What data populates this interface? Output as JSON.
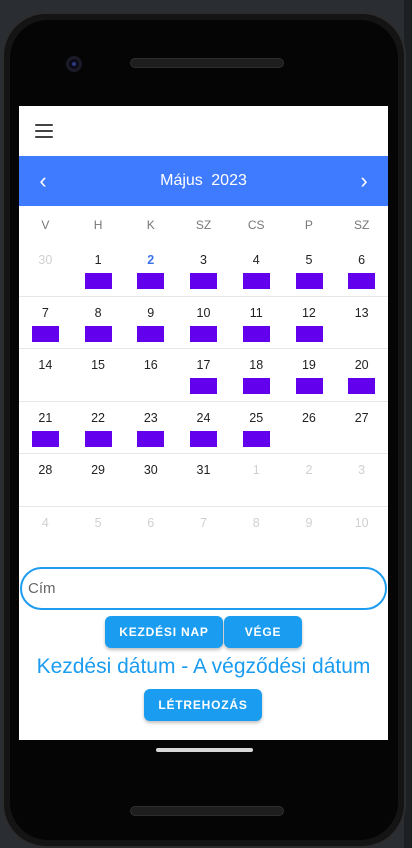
{
  "header": {
    "prev_icon": "‹",
    "month": "Május",
    "year": "2023",
    "next_icon": "›"
  },
  "weekdays": [
    "V",
    "H",
    "K",
    "SZ",
    "CS",
    "P",
    "SZ"
  ],
  "weeks": [
    [
      {
        "d": "30",
        "other": true,
        "evt": false
      },
      {
        "d": "1",
        "evt": true
      },
      {
        "d": "2",
        "today": true,
        "evt": true
      },
      {
        "d": "3",
        "evt": true
      },
      {
        "d": "4",
        "evt": true
      },
      {
        "d": "5",
        "evt": true
      },
      {
        "d": "6",
        "evt": true
      }
    ],
    [
      {
        "d": "7",
        "evt": true
      },
      {
        "d": "8",
        "evt": true
      },
      {
        "d": "9",
        "evt": true
      },
      {
        "d": "10",
        "evt": true
      },
      {
        "d": "11",
        "evt": true
      },
      {
        "d": "12",
        "evt": true
      },
      {
        "d": "13",
        "evt": false
      }
    ],
    [
      {
        "d": "14",
        "evt": false
      },
      {
        "d": "15",
        "evt": false
      },
      {
        "d": "16",
        "evt": false
      },
      {
        "d": "17",
        "evt": true
      },
      {
        "d": "18",
        "evt": true
      },
      {
        "d": "19",
        "evt": true
      },
      {
        "d": "20",
        "evt": true
      }
    ],
    [
      {
        "d": "21",
        "evt": true
      },
      {
        "d": "22",
        "evt": true
      },
      {
        "d": "23",
        "evt": true
      },
      {
        "d": "24",
        "evt": true
      },
      {
        "d": "25",
        "evt": true
      },
      {
        "d": "26",
        "evt": false
      },
      {
        "d": "27",
        "evt": false
      }
    ],
    [
      {
        "d": "28",
        "evt": false
      },
      {
        "d": "29",
        "evt": false
      },
      {
        "d": "30",
        "evt": false
      },
      {
        "d": "31",
        "evt": false
      },
      {
        "d": "1",
        "other": true,
        "evt": false
      },
      {
        "d": "2",
        "other": true,
        "evt": false
      },
      {
        "d": "3",
        "other": true,
        "evt": false
      }
    ],
    [
      {
        "d": "4",
        "other": true,
        "evt": false
      },
      {
        "d": "5",
        "other": true,
        "evt": false
      },
      {
        "d": "6",
        "other": true,
        "evt": false
      },
      {
        "d": "7",
        "other": true,
        "evt": false
      },
      {
        "d": "8",
        "other": true,
        "evt": false
      },
      {
        "d": "9",
        "other": true,
        "evt": false
      },
      {
        "d": "10",
        "other": true,
        "evt": false
      }
    ]
  ],
  "form": {
    "title_placeholder": "Cím",
    "start_label": "KEZDÉSI NAP",
    "end_label": "VÉGE",
    "range_text": "Kezdési dátum - A végződési dátum",
    "create_label": "LÉTREHOZÁS"
  },
  "colors": {
    "header_bg": "#3f7bff",
    "event": "#6200ee",
    "accent": "#1a9cf0"
  }
}
